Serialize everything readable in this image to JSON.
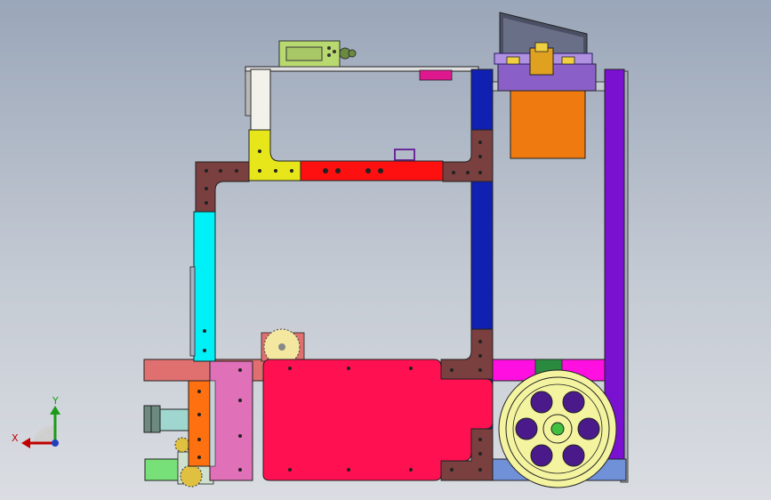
{
  "app": {
    "view": "cad-3d-viewport"
  },
  "triad": {
    "x_label": "X",
    "y_label": "Y"
  },
  "colors": {
    "background_top": "#9aa6b9",
    "background_bottom": "#dadde2",
    "frame_brown": "#7a3f3f",
    "frame_red": "#ff1010",
    "frame_yellow": "#e6e61a",
    "frame_cyan": "#00f0f8",
    "frame_blue": "#1020b0",
    "frame_purple": "#7a10d0",
    "panel_pink": "#ff1050",
    "panel_light_pink": "#e070b8",
    "panel_orange": "#ff7010",
    "panel_salmon": "#e07070",
    "panel_magenta": "#ff10e0",
    "panel_green": "#70e070",
    "wheel_yellow": "#f4f4a0",
    "wheel_holes": "#4a1a8a"
  },
  "components": [
    "electronic-speed-controller",
    "upper-frame",
    "brown-corner-brackets",
    "blue-vertical-rail",
    "purple-vertical-rail",
    "orange-battery-box",
    "top-camera-mount",
    "red-main-plate",
    "cyan-side-rail",
    "drive-wheel",
    "small-gear",
    "side-motor-shaft"
  ]
}
